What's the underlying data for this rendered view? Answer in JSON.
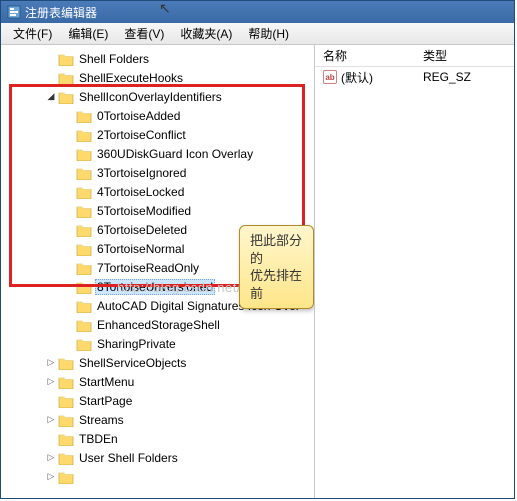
{
  "window": {
    "title": "注册表编辑器"
  },
  "menu": [
    "文件(F)",
    "编辑(E)",
    "查看(V)",
    "收藏夹(A)",
    "帮助(H)"
  ],
  "columns": {
    "name": "名称",
    "type": "类型"
  },
  "values": [
    {
      "name": "(默认)",
      "type": "REG_SZ"
    }
  ],
  "callout": {
    "line1": "把此部分的",
    "line2": "优先排在前"
  },
  "watermark": "http://blog.csdn.net/tcjy1000",
  "tree": [
    {
      "indent": 2,
      "toggle": "",
      "label": "Shell Folders"
    },
    {
      "indent": 2,
      "toggle": "",
      "label": "ShellExecuteHooks"
    },
    {
      "indent": 2,
      "toggle": "open",
      "label": "ShellIconOverlayIdentifiers"
    },
    {
      "indent": 3,
      "toggle": "",
      "label": "0TortoiseAdded"
    },
    {
      "indent": 3,
      "toggle": "",
      "label": "2TortoiseConflict"
    },
    {
      "indent": 3,
      "toggle": "",
      "label": "360UDiskGuard Icon Overlay"
    },
    {
      "indent": 3,
      "toggle": "",
      "label": "3TortoiseIgnored"
    },
    {
      "indent": 3,
      "toggle": "",
      "label": "4TortoiseLocked"
    },
    {
      "indent": 3,
      "toggle": "",
      "label": "5TortoiseModified"
    },
    {
      "indent": 3,
      "toggle": "",
      "label": "6TortoiseDeleted"
    },
    {
      "indent": 3,
      "toggle": "",
      "label": "6TortoiseNormal"
    },
    {
      "indent": 3,
      "toggle": "",
      "label": "7TortoiseReadOnly"
    },
    {
      "indent": 3,
      "toggle": "",
      "label": "8TortoiseUnversioned",
      "selected": true
    },
    {
      "indent": 3,
      "toggle": "",
      "label": "AutoCAD Digital Signatures Icon Over"
    },
    {
      "indent": 3,
      "toggle": "",
      "label": "EnhancedStorageShell"
    },
    {
      "indent": 3,
      "toggle": "",
      "label": "SharingPrivate"
    },
    {
      "indent": 2,
      "toggle": "closed",
      "label": "ShellServiceObjects"
    },
    {
      "indent": 2,
      "toggle": "closed",
      "label": "StartMenu"
    },
    {
      "indent": 2,
      "toggle": "",
      "label": "StartPage"
    },
    {
      "indent": 2,
      "toggle": "closed",
      "label": "Streams"
    },
    {
      "indent": 2,
      "toggle": "",
      "label": "TBDEn"
    },
    {
      "indent": 2,
      "toggle": "closed",
      "label": "User Shell Folders"
    },
    {
      "indent": 2,
      "toggle": "closed",
      "label": ""
    }
  ]
}
